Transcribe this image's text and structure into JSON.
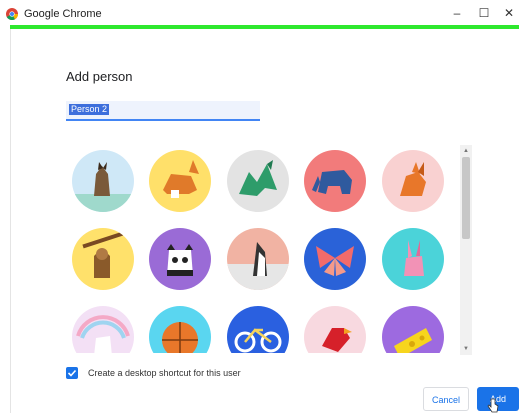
{
  "window": {
    "title": "Google Chrome",
    "minimize": "–",
    "maximize": "☐",
    "close": "✕"
  },
  "dialog": {
    "heading": "Add person",
    "name_value": "Person 2",
    "checkbox_label": "Create a desktop shortcut for this user",
    "checkbox_checked": true,
    "cancel_label": "Cancel",
    "add_label": "Add"
  },
  "colors": {
    "accent": "#1a73e8",
    "window_border": "#2ee82e"
  },
  "avatars": [
    {
      "name": "cat-icon",
      "bg": "#cfe8f7"
    },
    {
      "name": "corgi-icon",
      "bg": "#ffe06a"
    },
    {
      "name": "dragon-icon",
      "bg": "#e3e3e3"
    },
    {
      "name": "elephant-icon",
      "bg": "#f27b7b"
    },
    {
      "name": "fox-icon",
      "bg": "#f9d1d1"
    },
    {
      "name": "monkey-icon",
      "bg": "#ffe16b"
    },
    {
      "name": "panda-icon",
      "bg": "#9a6bd6"
    },
    {
      "name": "penguin-icon",
      "bg": "#f1b3a3"
    },
    {
      "name": "butterfly-icon",
      "bg": "#2a62d8"
    },
    {
      "name": "rabbit-icon",
      "bg": "#4bd3d9"
    },
    {
      "name": "unicorn-icon",
      "bg": "#f3e0f5"
    },
    {
      "name": "basketball-icon",
      "bg": "#5ad6f0"
    },
    {
      "name": "bicycle-icon",
      "bg": "#2a60e0"
    },
    {
      "name": "bird-icon",
      "bg": "#f8d9e0"
    },
    {
      "name": "cheese-icon",
      "bg": "#9d6ae0"
    }
  ]
}
